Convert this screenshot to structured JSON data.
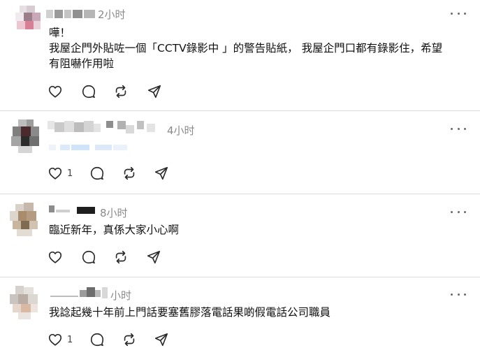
{
  "posts": [
    {
      "time": "2小时",
      "lines": [
        "嘩！",
        "我屋企門外貼咗一個「CCTV錄影中 」的警告貼紙， 我屋企門口都有錄影住，希望",
        "有阻嚇作用啦"
      ],
      "like_count": "",
      "more_icon": "more-horizontal-icon"
    },
    {
      "time": "4小时",
      "lines": [],
      "like_count": "1"
    },
    {
      "time": "8小时",
      "lines": [
        "臨近新年，真係大家小心啊"
      ],
      "like_count": ""
    },
    {
      "time": "小时",
      "lines": [
        "我諗起幾十年前上門話要塞舊膠落電話果啲假電話公司職員"
      ],
      "like_count": "1"
    }
  ],
  "icons": {
    "like": "heart-icon",
    "reply": "comment-icon",
    "repost": "repost-icon",
    "share": "send-icon",
    "more": "more-horizontal-icon"
  },
  "colors": {
    "text": "#101010",
    "muted": "#8a8a8a",
    "divider": "#dcdcdc",
    "icon": "#2b2b2b"
  }
}
